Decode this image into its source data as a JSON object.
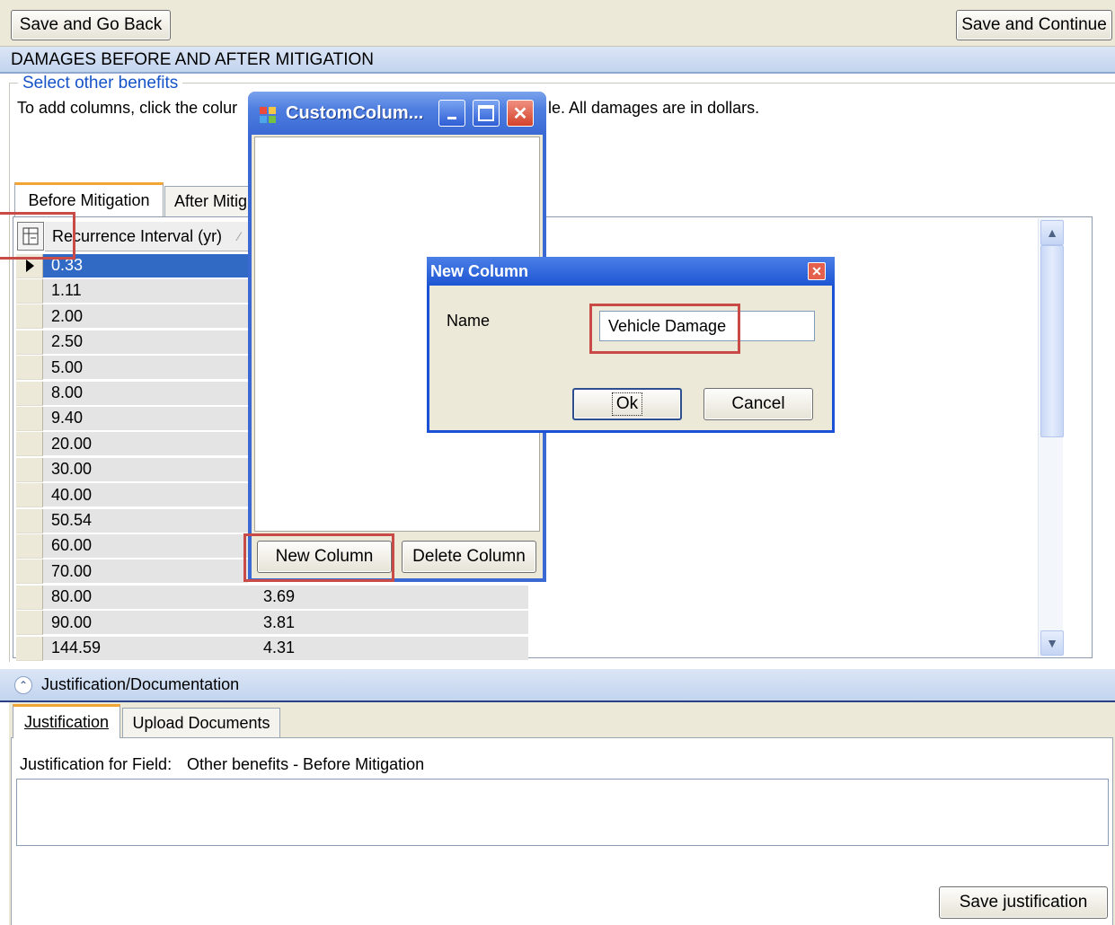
{
  "toolbar": {
    "save_back": "Save and Go Back",
    "save_continue": "Save and Continue"
  },
  "section": {
    "title": "DAMAGES BEFORE AND AFTER MITIGATION",
    "group_label": "Select other benefits",
    "instructions_left": "To add columns, click the colur",
    "instructions_right": "le. All damages are in dollars."
  },
  "tabs": [
    {
      "label": "Before Mitigation"
    },
    {
      "label": "After Mitig"
    }
  ],
  "grid": {
    "column_header": "Recurrence Interval (yr)",
    "rows": [
      {
        "interval": "0.33",
        "value": ""
      },
      {
        "interval": "1.11",
        "value": ""
      },
      {
        "interval": "2.00",
        "value": ""
      },
      {
        "interval": "2.50",
        "value": ""
      },
      {
        "interval": "5.00",
        "value": ""
      },
      {
        "interval": "8.00",
        "value": ""
      },
      {
        "interval": "9.40",
        "value": ""
      },
      {
        "interval": "20.00",
        "value": ""
      },
      {
        "interval": "30.00",
        "value": ""
      },
      {
        "interval": "40.00",
        "value": ""
      },
      {
        "interval": "50.54",
        "value": ""
      },
      {
        "interval": "60.00",
        "value": ""
      },
      {
        "interval": "70.00",
        "value": ""
      },
      {
        "interval": "80.00",
        "value": "3.69"
      },
      {
        "interval": "90.00",
        "value": "3.81"
      },
      {
        "interval": "144.59",
        "value": "4.31"
      }
    ]
  },
  "custom_window": {
    "title": "CustomColum...",
    "new_column": "New Column",
    "delete_column": "Delete Column"
  },
  "dialog": {
    "title": "New Column",
    "name_label": "Name",
    "name_value": "Vehicle Damage",
    "ok": "Ok",
    "cancel": "Cancel"
  },
  "justification": {
    "header": "Justification/Documentation",
    "tabs": [
      {
        "label": "Justification"
      },
      {
        "label": "Upload Documents"
      }
    ],
    "field_label": "Justification for Field:",
    "field_value": "Other benefits - Before Mitigation",
    "save_button": "Save justification"
  },
  "colors": {
    "header_band": "#c3d4ee",
    "xp_title_blue": "#0b4fd8",
    "highlight_red": "#c84b48",
    "selected_row": "#316ac5"
  }
}
